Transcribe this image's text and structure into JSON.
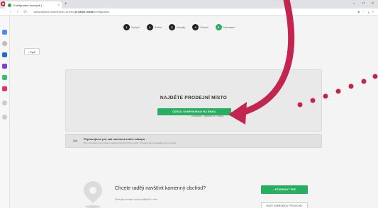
{
  "browser": {
    "tab_title": "Konfigurátor kuchyně | ...",
    "tab_close": "×",
    "new_tab": "+",
    "window_controls": [
      "–",
      "□",
      "×"
    ],
    "url_prefix": "www.sykora.cz/kuchyne-na-miru/",
    "url_highlight": "prodejni-mista",
    "url_suffix": "/konfigurator/",
    "nav": [
      "‹",
      "›",
      "⟳"
    ]
  },
  "stepper": {
    "steps": [
      {
        "num": "1",
        "label": "Kuchyň"
      },
      {
        "num": "2",
        "label": "Dvířka"
      },
      {
        "num": "3",
        "label": "Úchytky"
      },
      {
        "num": "4",
        "label": "Shrnutí"
      },
      {
        "num": "5",
        "label": "Dokončení"
      }
    ]
  },
  "back_label": "‹ Zpět",
  "card": {
    "title": "NAJDĚTE PRODEJNÍ MÍSTO",
    "text": "Odešlete konfiguraci třeba k nejbližšímu obchodníkovi, nebo nejbližší prodejně – vyberte si z mapy.",
    "button": "ODEŠLI KONFIGURACI NA EMAIL"
  },
  "info": {
    "title": "Připravujeme pro vás možnost online nákupu",
    "text": "Brzy si budete moci vybrat a zakoupit kuchyň přímo online. Prozatím nás kontaktujte přes formulář."
  },
  "bottom": {
    "question": "Chcete raději navštívit kamenný obchod?",
    "text": "Sledujte prodejní místa\nnejbližší k vám",
    "green_button": "↓ STÁHNOUT PDF",
    "outline_button": "NAJÍT KAMENNOU PRODEJNU"
  },
  "colors": {
    "accent": "#27ae60",
    "annotation": "#c2264f"
  }
}
